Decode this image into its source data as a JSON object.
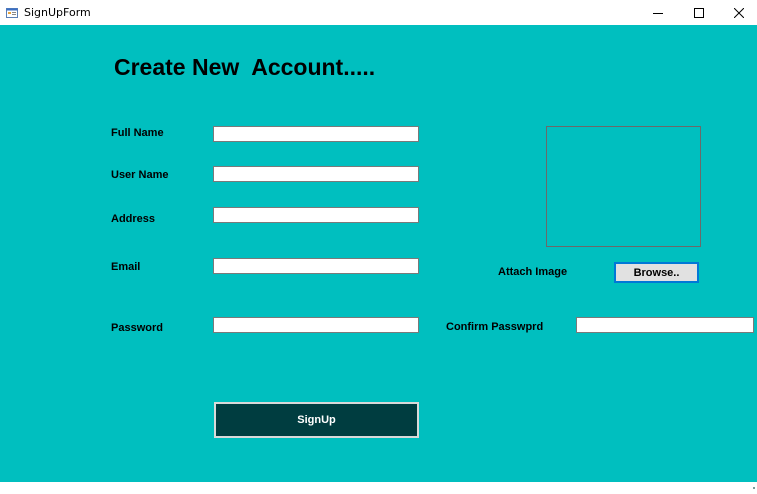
{
  "window": {
    "title": "SignUpForm",
    "icons": {
      "app": "form-app-icon",
      "minimize": "minimize-icon",
      "maximize": "maximize-icon",
      "close": "close-icon"
    }
  },
  "form": {
    "heading": "Create New  Account.....",
    "labels": {
      "full_name": "Full Name",
      "user_name": "User Name",
      "address": "Address",
      "email": "Email",
      "password": "Password",
      "confirm_password": "Confirm Passwprd",
      "attach_image": "Attach Image"
    },
    "fields": {
      "full_name": "",
      "user_name": "",
      "address": "",
      "email": "",
      "password": "",
      "confirm_password": ""
    },
    "buttons": {
      "browse": "Browse..",
      "signup": "SignUp"
    }
  },
  "colors": {
    "background": "#00bfbf",
    "signup_button": "#003d40",
    "browse_focus_border": "#0078d7"
  }
}
